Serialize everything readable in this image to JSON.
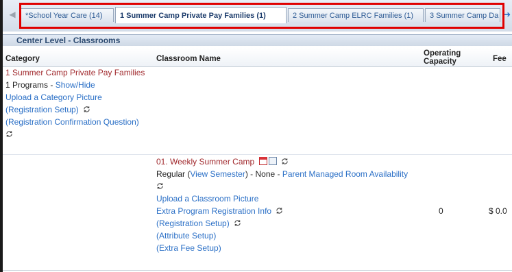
{
  "tabs": [
    {
      "label": "*School Year Care (14)"
    },
    {
      "label": "1 Summer Camp Private Pay Families (1)"
    },
    {
      "label": "2 Summer Camp ELRC Families (1)"
    },
    {
      "label": "3 Summer Camp Da"
    }
  ],
  "section_title": "Center Level - Classrooms",
  "columns": {
    "category": "Category",
    "classroom_name": "Classroom Name",
    "operating_capacity": "Operating Capacity",
    "fee": "Fee"
  },
  "category_block": {
    "name": "1 Summer Camp Private Pay Families",
    "programs_prefix": "1 Programs - ",
    "show_hide": "Show/Hide",
    "upload_picture": "Upload a Category Picture",
    "registration_setup": "(Registration Setup)",
    "confirmation_question": "(Registration Confirmation Question)"
  },
  "classroom": {
    "name": "01. Weekly Summer Camp",
    "regular_prefix": "Regular (",
    "view_semester": "View Semester",
    "none_text": ") - None - ",
    "parent_managed": "Parent Managed Room Availability",
    "upload_picture": "Upload a Classroom Picture",
    "extra_info": "Extra Program Registration Info",
    "registration_setup": "(Registration Setup)",
    "attribute_setup": "(Attribute Setup)",
    "extra_fee_setup": "(Extra Fee Setup)",
    "capacity": "0",
    "fee": "$ 0.0"
  },
  "colors": {
    "accent_red": "#e00000",
    "maroon": "#a0282c",
    "link_blue": "#2a6fc6"
  }
}
